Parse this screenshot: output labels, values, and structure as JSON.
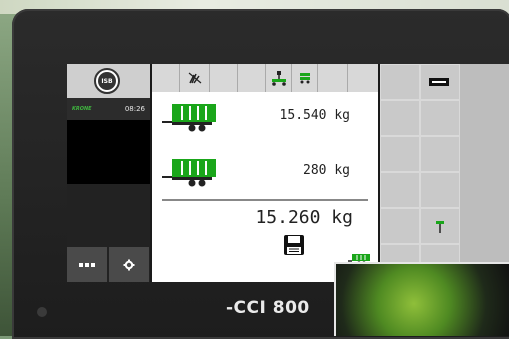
{
  "isb": {
    "label": "ISB"
  },
  "status": {
    "brand": "KRONE",
    "time": "08:26"
  },
  "weights": {
    "row1": {
      "value": "15.540 kg"
    },
    "row2": {
      "value": "280 kg"
    },
    "net": {
      "value": "15.260 kg"
    }
  },
  "branding": {
    "logo": "-CCI 800"
  },
  "colors": {
    "accent_green": "#1aa61a",
    "screen_bg": "#ffffff",
    "softkey_bg": "#c9c9c9"
  },
  "icons": {
    "topbar": [
      "grass-icon",
      "scale-hitch-icon",
      "trailer-small-icon"
    ],
    "left": [
      "menu-dots-icon",
      "settings-gear-icon"
    ],
    "right": [
      "minus-icon",
      "tare-icon"
    ],
    "bottom": [
      "save-icon",
      "trailer-small-icon"
    ]
  }
}
